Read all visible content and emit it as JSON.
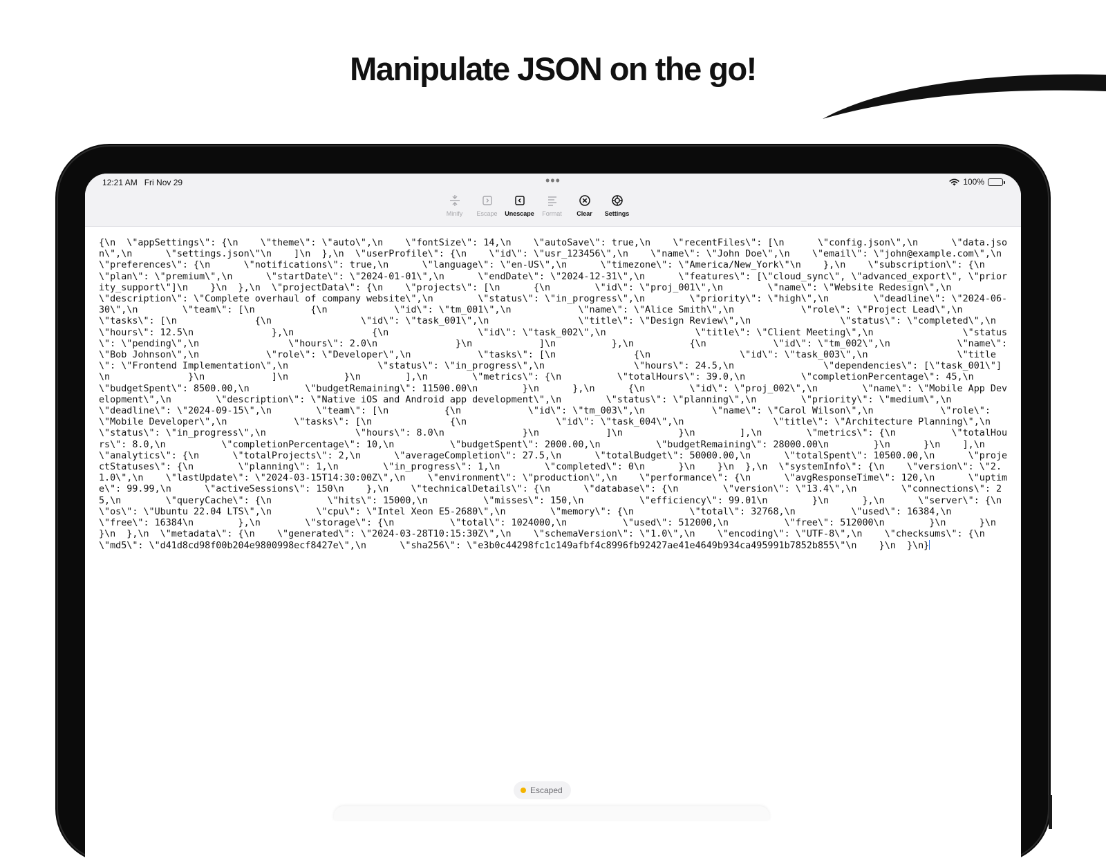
{
  "headline": "Manipulate JSON on the go!",
  "status_bar": {
    "time": "12:21 AM",
    "date": "Fri Nov 29",
    "battery": "100%"
  },
  "toolbar": [
    {
      "label": "Minify",
      "icon": "minify-icon",
      "enabled": false
    },
    {
      "label": "Escape",
      "icon": "escape-icon",
      "enabled": false
    },
    {
      "label": "Unescape",
      "icon": "unescape-icon",
      "enabled": true
    },
    {
      "label": "Format",
      "icon": "format-icon",
      "enabled": false
    },
    {
      "label": "Clear",
      "icon": "clear-icon",
      "enabled": true
    },
    {
      "label": "Settings",
      "icon": "settings-icon",
      "enabled": true
    }
  ],
  "editor": {
    "content": "{\\n  \\\"appSettings\\\": {\\n    \\\"theme\\\": \\\"auto\\\",\\n    \\\"fontSize\\\": 14,\\n    \\\"autoSave\\\": true,\\n    \\\"recentFiles\\\": [\\n      \\\"config.json\\\",\\n      \\\"data.json\\\",\\n      \\\"settings.json\\\"\\n    ]\\n  },\\n  \\\"userProfile\\\": {\\n    \\\"id\\\": \\\"usr_123456\\\",\\n    \\\"name\\\": \\\"John Doe\\\",\\n    \\\"email\\\": \\\"john@example.com\\\",\\n    \\\"preferences\\\": {\\n      \\\"notifications\\\": true,\\n      \\\"language\\\": \\\"en-US\\\",\\n      \\\"timezone\\\": \\\"America/New_York\\\"\\n    },\\n    \\\"subscription\\\": {\\n      \\\"plan\\\": \\\"premium\\\",\\n      \\\"startDate\\\": \\\"2024-01-01\\\",\\n      \\\"endDate\\\": \\\"2024-12-31\\\",\\n      \\\"features\\\": [\\\"cloud_sync\\\", \\\"advanced_export\\\", \\\"priority_support\\\"]\\n    }\\n  },\\n  \\\"projectData\\\": {\\n    \\\"projects\\\": [\\n      {\\n        \\\"id\\\": \\\"proj_001\\\",\\n        \\\"name\\\": \\\"Website Redesign\\\",\\n        \\\"description\\\": \\\"Complete overhaul of company website\\\",\\n        \\\"status\\\": \\\"in_progress\\\",\\n        \\\"priority\\\": \\\"high\\\",\\n        \\\"deadline\\\": \\\"2024-06-30\\\",\\n        \\\"team\\\": [\\n          {\\n            \\\"id\\\": \\\"tm_001\\\",\\n            \\\"name\\\": \\\"Alice Smith\\\",\\n            \\\"role\\\": \\\"Project Lead\\\",\\n            \\\"tasks\\\": [\\n              {\\n                \\\"id\\\": \\\"task_001\\\",\\n                \\\"title\\\": \\\"Design Review\\\",\\n                \\\"status\\\": \\\"completed\\\",\\n                \\\"hours\\\": 12.5\\n              },\\n              {\\n                \\\"id\\\": \\\"task_002\\\",\\n                \\\"title\\\": \\\"Client Meeting\\\",\\n                \\\"status\\\": \\\"pending\\\",\\n                \\\"hours\\\": 2.0\\n              }\\n            ]\\n          },\\n          {\\n            \\\"id\\\": \\\"tm_002\\\",\\n            \\\"name\\\": \\\"Bob Johnson\\\",\\n            \\\"role\\\": \\\"Developer\\\",\\n            \\\"tasks\\\": [\\n              {\\n                \\\"id\\\": \\\"task_003\\\",\\n                \\\"title\\\": \\\"Frontend Implementation\\\",\\n                \\\"status\\\": \\\"in_progress\\\",\\n                \\\"hours\\\": 24.5,\\n                \\\"dependencies\\\": [\\\"task_001\\\"]\\n              }\\n            ]\\n          }\\n        ],\\n        \\\"metrics\\\": {\\n          \\\"totalHours\\\": 39.0,\\n          \\\"completionPercentage\\\": 45,\\n          \\\"budgetSpent\\\": 8500.00,\\n          \\\"budgetRemaining\\\": 11500.00\\n        }\\n      },\\n      {\\n        \\\"id\\\": \\\"proj_002\\\",\\n        \\\"name\\\": \\\"Mobile App Development\\\",\\n        \\\"description\\\": \\\"Native iOS and Android app development\\\",\\n        \\\"status\\\": \\\"planning\\\",\\n        \\\"priority\\\": \\\"medium\\\",\\n        \\\"deadline\\\": \\\"2024-09-15\\\",\\n        \\\"team\\\": [\\n          {\\n            \\\"id\\\": \\\"tm_003\\\",\\n            \\\"name\\\": \\\"Carol Wilson\\\",\\n            \\\"role\\\": \\\"Mobile Developer\\\",\\n            \\\"tasks\\\": [\\n              {\\n                \\\"id\\\": \\\"task_004\\\",\\n                \\\"title\\\": \\\"Architecture Planning\\\",\\n                \\\"status\\\": \\\"in_progress\\\",\\n                \\\"hours\\\": 8.0\\n              }\\n            ]\\n          }\\n        ],\\n        \\\"metrics\\\": {\\n          \\\"totalHours\\\": 8.0,\\n          \\\"completionPercentage\\\": 10,\\n          \\\"budgetSpent\\\": 2000.00,\\n          \\\"budgetRemaining\\\": 28000.00\\n        }\\n      }\\n    ],\\n    \\\"analytics\\\": {\\n      \\\"totalProjects\\\": 2,\\n      \\\"averageCompletion\\\": 27.5,\\n      \\\"totalBudget\\\": 50000.00,\\n      \\\"totalSpent\\\": 10500.00,\\n      \\\"projectStatuses\\\": {\\n        \\\"planning\\\": 1,\\n        \\\"in_progress\\\": 1,\\n        \\\"completed\\\": 0\\n      }\\n    }\\n  },\\n  \\\"systemInfo\\\": {\\n    \\\"version\\\": \\\"2.1.0\\\",\\n    \\\"lastUpdate\\\": \\\"2024-03-15T14:30:00Z\\\",\\n    \\\"environment\\\": \\\"production\\\",\\n    \\\"performance\\\": {\\n      \\\"avgResponseTime\\\": 120,\\n      \\\"uptime\\\": 99.99,\\n      \\\"activeSessions\\\": 150\\n    },\\n    \\\"technicalDetails\\\": {\\n      \\\"database\\\": {\\n        \\\"version\\\": \\\"13.4\\\",\\n        \\\"connections\\\": 25,\\n        \\\"queryCache\\\": {\\n          \\\"hits\\\": 15000,\\n          \\\"misses\\\": 150,\\n          \\\"efficiency\\\": 99.01\\n        }\\n      },\\n      \\\"server\\\": {\\n        \\\"os\\\": \\\"Ubuntu 22.04 LTS\\\",\\n        \\\"cpu\\\": \\\"Intel Xeon E5-2680\\\",\\n        \\\"memory\\\": {\\n          \\\"total\\\": 32768,\\n          \\\"used\\\": 16384,\\n          \\\"free\\\": 16384\\n        },\\n        \\\"storage\\\": {\\n          \\\"total\\\": 1024000,\\n          \\\"used\\\": 512000,\\n          \\\"free\\\": 512000\\n        }\\n      }\\n    }\\n  },\\n  \\\"metadata\\\": {\\n    \\\"generated\\\": \\\"2024-03-28T10:15:30Z\\\",\\n    \\\"schemaVersion\\\": \\\"1.0\\\",\\n    \\\"encoding\\\": \\\"UTF-8\\\",\\n    \\\"checksums\\\": {\\n      \\\"md5\\\": \\\"d41d8cd98f00b204e9800998ecf8427e\\\",\\n      \\\"sha256\\\": \\\"e3b0c44298fc1c149afbf4c8996fb92427ae41e4649b934ca495991b7852b855\\\"\\n    }\\n  }\\n}"
  },
  "status_pill": {
    "label": "Escaped",
    "dot_color": "#f4b400"
  }
}
